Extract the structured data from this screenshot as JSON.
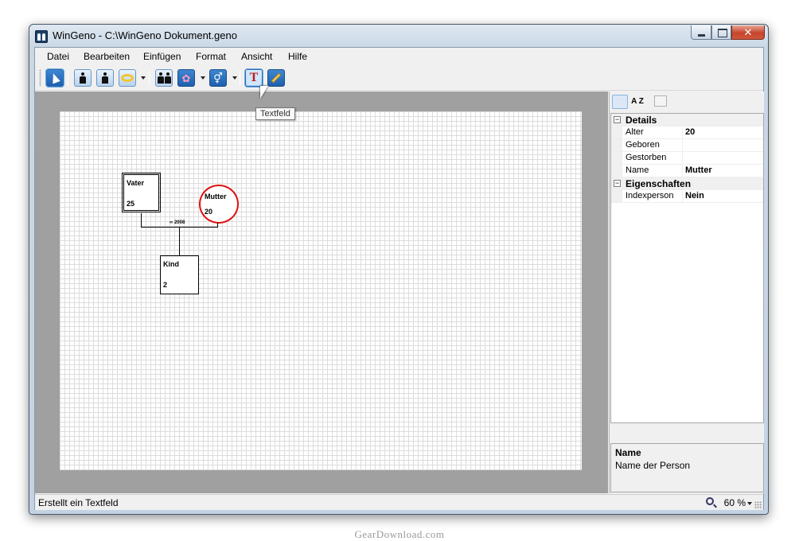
{
  "window": {
    "title": "WinGeno - C:\\WinGeno Dokument.geno",
    "close_symbol": "✕"
  },
  "menu": [
    "Datei",
    "Bearbeiten",
    "Einfügen",
    "Format",
    "Ansicht",
    "Hilfe"
  ],
  "toolbar": {
    "icons": [
      "select-pointer-icon",
      "male-person-icon",
      "female-person-icon",
      "marriage-rings-icon",
      "couple-icon",
      "child-stroller-icon",
      "gender-symbol-icon",
      "textfield-icon",
      "pen-icon"
    ],
    "textfield_glyph": "T",
    "tooltip": "Textfeld"
  },
  "diagram": {
    "father": {
      "name": "Vater",
      "age": "25"
    },
    "mother": {
      "name": "Mutter",
      "age": "20"
    },
    "child": {
      "name": "Kind",
      "age": "2"
    },
    "marriage_label": "∞ 2008"
  },
  "properties": {
    "sort_alpha_label": "A Z",
    "categories": [
      {
        "label": "Details",
        "expander": "−",
        "rows": [
          {
            "name": "Alter",
            "value": "20"
          },
          {
            "name": "Geboren",
            "value": ""
          },
          {
            "name": "Gestorben",
            "value": ""
          },
          {
            "name": "Name",
            "value": "Mutter"
          }
        ]
      },
      {
        "label": "Eigenschaften",
        "expander": "−",
        "rows": [
          {
            "name": "Indexperson",
            "value": "Nein"
          }
        ]
      }
    ],
    "description": {
      "title": "Name",
      "text": "Name der Person"
    }
  },
  "status": {
    "text": "Erstellt ein Textfeld",
    "zoom": "60 %"
  },
  "watermark": "GearDownload.com",
  "colors": {
    "accent_button": "#1e5fae",
    "selected_circle": "#e01010",
    "canvas_bg": "#a0a0a0"
  }
}
